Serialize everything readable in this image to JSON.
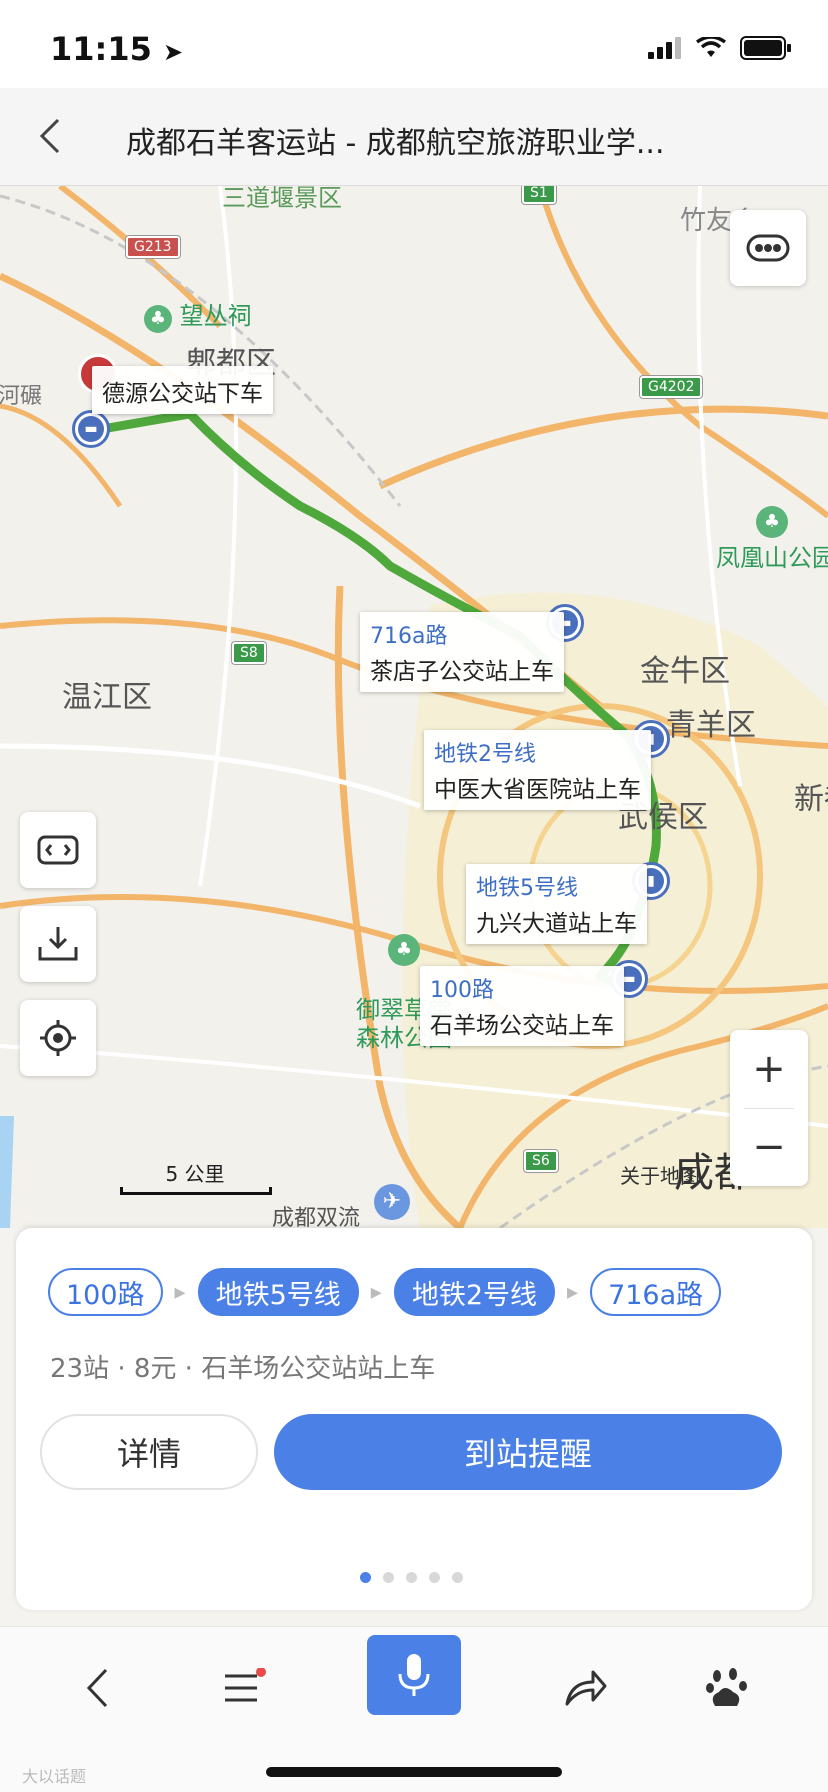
{
  "status_bar": {
    "time": "11:15"
  },
  "header": {
    "title": "成都石羊客运站 - 成都航空旅游职业学..."
  },
  "map": {
    "labels": {
      "scenic": "三道堰景区",
      "wangcong": "望丛祠",
      "pidu": "郫都区",
      "zhuyou": "竹友乡",
      "hehe": "河碾",
      "fenghuang": "凤凰山公园",
      "wenjiang": "温江区",
      "jinniu": "金牛区",
      "qingyang": "青羊区",
      "wuhou": "武侯区",
      "xindu": "新都",
      "yucui": "御翠草堂\n森林公园",
      "shuangliu": "成都双流\n国际机场",
      "chengdu": "成都",
      "about_map": "关于地图"
    },
    "road_badges": {
      "s1": "S1",
      "g213": "G213",
      "g4202": "G4202",
      "s8": "S8",
      "s6": "S6"
    },
    "callouts": [
      {
        "line": "",
        "stop": "德源公交站下车"
      },
      {
        "line": "716a路",
        "stop": "茶店子公交站上车"
      },
      {
        "line": "地铁2号线",
        "stop": "中医大省医院站上车"
      },
      {
        "line": "地铁5号线",
        "stop": "九兴大道站上车"
      },
      {
        "line": "100路",
        "stop": "石羊场公交站上车"
      }
    ],
    "scale": "5 公里",
    "zoom_in": "+",
    "zoom_out": "−",
    "route_color": "#4fa83c"
  },
  "panel": {
    "chips": [
      {
        "label": "100路",
        "style": "outline"
      },
      {
        "label": "地铁5号线",
        "style": "filled"
      },
      {
        "label": "地铁2号线",
        "style": "filled"
      },
      {
        "label": "716a路",
        "style": "outline"
      }
    ],
    "summary": "23站 · 8元 · 石羊场公交站站上车",
    "detail_label": "详情",
    "remind_label": "到站提醒",
    "page_count": 5,
    "active_page": 1
  },
  "bottom_bar": {
    "icons": [
      "back-icon",
      "menu-icon",
      "mic-icon",
      "share-icon",
      "baidu-paw-icon"
    ]
  },
  "watermark": "大以话题",
  "colors": {
    "accent": "#4b80e6"
  }
}
